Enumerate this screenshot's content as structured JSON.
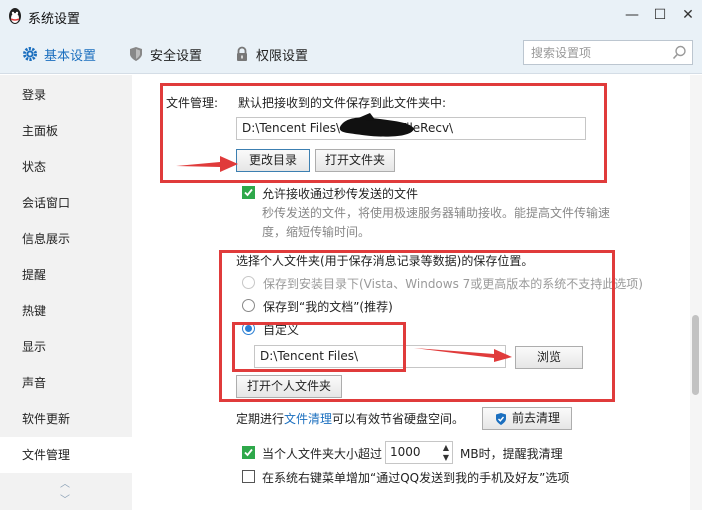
{
  "window": {
    "title": "系统设置",
    "min_icon": "minimize-icon",
    "max_icon": "maximize-icon",
    "close_icon": "close-icon"
  },
  "tabs": [
    {
      "label": "基本设置",
      "icon": "gear-icon",
      "active": true
    },
    {
      "label": "安全设置",
      "icon": "shield-icon",
      "active": false
    },
    {
      "label": "权限设置",
      "icon": "lock-icon",
      "active": false
    }
  ],
  "search": {
    "placeholder": "搜索设置项"
  },
  "sidebar": {
    "items": [
      {
        "label": "登录"
      },
      {
        "label": "主面板"
      },
      {
        "label": "状态"
      },
      {
        "label": "会话窗口"
      },
      {
        "label": "信息展示"
      },
      {
        "label": "提醒"
      },
      {
        "label": "热键"
      },
      {
        "label": "显示"
      },
      {
        "label": "声音"
      },
      {
        "label": "软件更新"
      },
      {
        "label": "文件管理",
        "active": true
      }
    ],
    "scroll_up": "︿",
    "scroll_down": "﹀"
  },
  "file_mgmt": {
    "section_label": "文件管理:",
    "default_save_label": "默认把接收到的文件保存到此文件夹中:",
    "path_prefix": "D:\\Tencent Files\\",
    "path_suffix": "FileRecv\\",
    "change_dir_button": "更改目录",
    "open_folder_button": "打开文件夹",
    "allow_label": "允许接收通过秒传发送的文件",
    "allow_desc": "秒传发送的文件，将使用极速服务器辅助接收。能提高文件传输速度，缩短传输时间。",
    "personal_folder_label": "选择个人文件夹(用于保存消息记录等数据)的保存位置。",
    "option_install": "保存到安装目录下(Vista、Windows 7或更高版本的系统不支持此选项)",
    "option_docs": "保存到“我的文档”(推荐)",
    "option_custom": "自定义",
    "custom_path": "D:\\Tencent Files\\",
    "browse_button": "浏览",
    "open_personal_button": "打开个人文件夹",
    "cleanup_prefix": "定期进行",
    "cleanup_link": "文件清理",
    "cleanup_suffix": "可以有效节省硬盘空间。",
    "cleanup_button": "前去清理",
    "size_prefix": "当个人文件夹大小超过",
    "size_value": "1000",
    "size_suffix": "MB时，提醒我清理",
    "context_menu_label": "在系统右键菜单增加“通过QQ发送到我的手机及好友”选项"
  },
  "colors": {
    "accent": "#1b6fbf",
    "annotation": "#e03b3b",
    "check": "#2ea84a"
  }
}
